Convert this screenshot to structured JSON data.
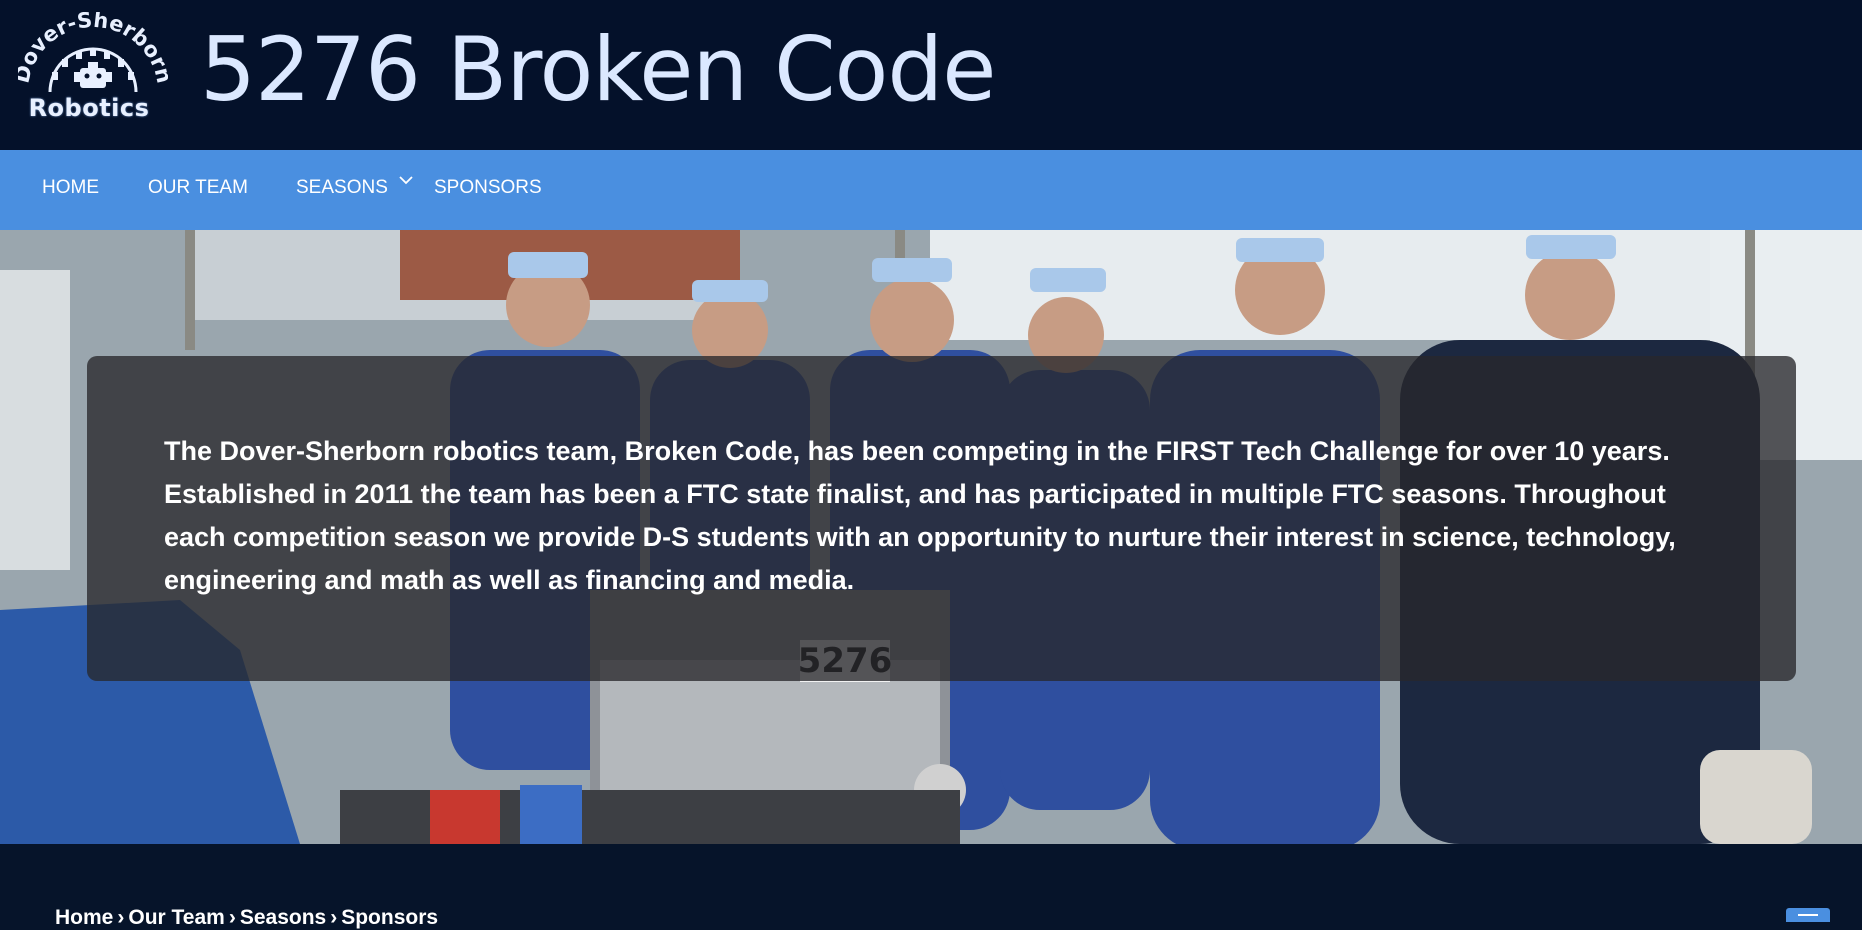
{
  "header": {
    "logo_top_text": "Dover-Sherborn",
    "logo_bottom_text": "Robotics",
    "site_title": "5276 Broken Code"
  },
  "nav": {
    "items": [
      {
        "label": "HOME"
      },
      {
        "label": "OUR TEAM"
      },
      {
        "label": "SEASONS",
        "has_dropdown": true
      },
      {
        "label": "SPONSORS"
      }
    ]
  },
  "hero": {
    "intro_text": "The Dover-Sherborn robotics team, Broken Code, has been competing in the FIRST Tech Challenge for over 10 years. Established in 2011 the team has been a FTC state finalist, and has participated in multiple FTC seasons. Throughout each competition season we provide D-S students with an opportunity to nurture their interest in science, technology, engineering and math as well as financing and media.",
    "robot_number": "5276"
  },
  "footer": {
    "breadcrumb": [
      {
        "label": "Home"
      },
      {
        "label": "Our Team"
      },
      {
        "label": "Seasons"
      },
      {
        "label": "Sponsors"
      }
    ],
    "separator": "›"
  },
  "colors": {
    "header_bg": "#04112a",
    "nav_bg": "#4a8fe0",
    "title_color": "#dbe8ff",
    "footer_bg": "#06142a"
  }
}
